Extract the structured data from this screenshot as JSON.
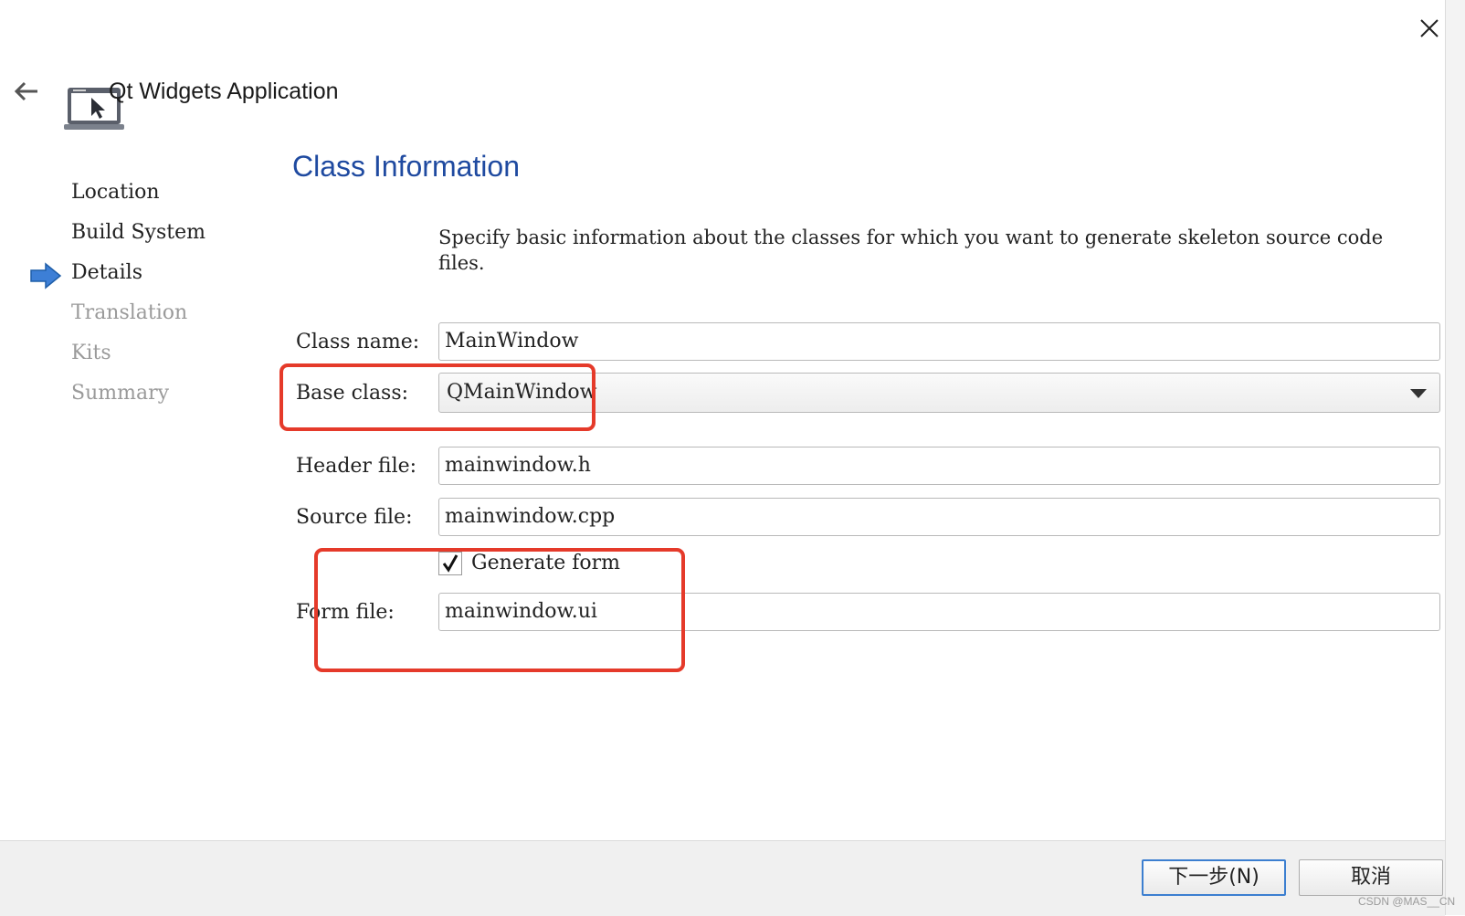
{
  "header": {
    "title": "Qt Widgets Application",
    "back_icon": "back-arrow-icon",
    "close_icon": "close-icon",
    "app_icon": "qt-widgets-application-icon"
  },
  "steps": [
    {
      "label": "Location",
      "state": "done"
    },
    {
      "label": "Build System",
      "state": "done"
    },
    {
      "label": "Details",
      "state": "current"
    },
    {
      "label": "Translation",
      "state": "pending"
    },
    {
      "label": "Kits",
      "state": "pending"
    },
    {
      "label": "Summary",
      "state": "pending"
    }
  ],
  "page": {
    "title": "Class Information",
    "description": "Specify basic information about the classes for which you want to generate skeleton source code files."
  },
  "form": {
    "class_name_label": "Class name:",
    "class_name_value": "MainWindow",
    "base_class_label": "Base class:",
    "base_class_value": "QMainWindow",
    "header_file_label": "Header file:",
    "header_file_value": "mainwindow.h",
    "source_file_label": "Source file:",
    "source_file_value": "mainwindow.cpp",
    "generate_form_label": "Generate form",
    "generate_form_checked": true,
    "form_file_label": "Form file:",
    "form_file_value": "mainwindow.ui"
  },
  "footer": {
    "next_label": "下一步(N)",
    "cancel_label": "取消"
  },
  "watermark": "CSDN @MAS__CN",
  "colors": {
    "title_blue": "#1f4aa0",
    "annotation_red": "#e53a2a",
    "step_arrow_blue": "#3d7fd6",
    "primary_border": "#3c7fd0"
  }
}
